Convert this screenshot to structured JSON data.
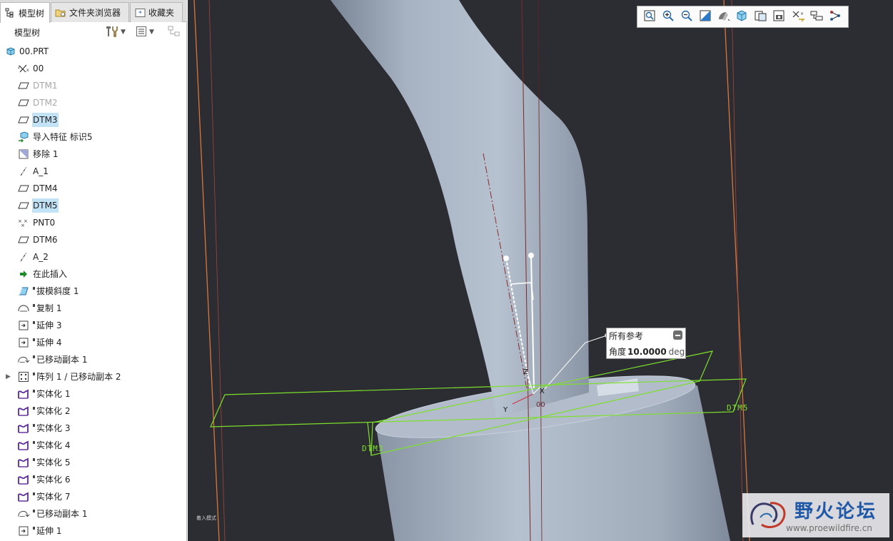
{
  "tabs": [
    {
      "label": "模型树",
      "icon": "tree-icon",
      "active": true
    },
    {
      "label": "文件夹浏览器",
      "icon": "folder-browser-icon",
      "active": false
    },
    {
      "label": "收藏夹",
      "icon": "favorites-icon",
      "active": false
    }
  ],
  "tree_header": {
    "title": "模型树"
  },
  "tree": [
    {
      "label": "00.PRT",
      "icon": "part-icon"
    },
    {
      "label": "00",
      "icon": "csys-icon"
    },
    {
      "label": "DTM1",
      "icon": "datum-plane-icon",
      "dim": true
    },
    {
      "label": "DTM2",
      "icon": "datum-plane-icon",
      "dim": true
    },
    {
      "label": "DTM3",
      "icon": "datum-plane-icon",
      "selected": true
    },
    {
      "label": "导入特征 标识5",
      "icon": "import-feature-icon"
    },
    {
      "label": "移除 1",
      "icon": "remove-icon"
    },
    {
      "label": "A_1",
      "icon": "datum-axis-icon"
    },
    {
      "label": "DTM4",
      "icon": "datum-plane-icon"
    },
    {
      "label": "DTM5",
      "icon": "datum-plane-icon",
      "selected": true
    },
    {
      "label": "PNT0",
      "icon": "datum-point-icon"
    },
    {
      "label": "DTM6",
      "icon": "datum-plane-icon"
    },
    {
      "label": "A_2",
      "icon": "datum-axis-icon"
    },
    {
      "label": "在此插入",
      "icon": "insert-here-arrow-icon"
    },
    {
      "label": "拔模斜度 1",
      "icon": "draft-icon",
      "marker": true
    },
    {
      "label": "复制 1",
      "icon": "copy-icon",
      "marker": true
    },
    {
      "label": "延伸 3",
      "icon": "extend-icon",
      "marker": true
    },
    {
      "label": "延伸 4",
      "icon": "extend-icon",
      "marker": true
    },
    {
      "label": "已移动副本 1",
      "icon": "moved-copy-icon",
      "marker": true
    },
    {
      "label": "阵列 1 / 已移动副本 2",
      "icon": "pattern-icon",
      "marker": true,
      "expandable": true
    },
    {
      "label": "实体化 1",
      "icon": "solidify-icon",
      "marker": true
    },
    {
      "label": "实体化 2",
      "icon": "solidify-icon",
      "marker": true
    },
    {
      "label": "实体化 3",
      "icon": "solidify-icon",
      "marker": true
    },
    {
      "label": "实体化 4",
      "icon": "solidify-icon",
      "marker": true
    },
    {
      "label": "实体化 5",
      "icon": "solidify-icon",
      "marker": true
    },
    {
      "label": "实体化 6",
      "icon": "solidify-icon",
      "marker": true
    },
    {
      "label": "实体化 7",
      "icon": "solidify-icon",
      "marker": true
    },
    {
      "label": "已移动副本 1",
      "icon": "moved-copy-icon",
      "marker": true
    },
    {
      "label": "延伸 1",
      "icon": "extend-icon",
      "marker": true
    }
  ],
  "view_toolbar": [
    "refit-icon",
    "zoom-in-icon",
    "zoom-out-icon",
    "repaint-icon",
    "display-style-icon",
    "saved-orientations-icon",
    "view-manager-icon",
    "perspective-icon",
    "datum-display-icon",
    "spin-center-icon",
    "annotation-display-icon"
  ],
  "dimension_callout": {
    "header": "所有参考",
    "label": "角度",
    "value": "10.0000",
    "unit": "deg"
  },
  "scene_labels": {
    "dtm3": "DTM3",
    "dtm5": "DTM5",
    "axis_x": "X",
    "axis_y": "Y",
    "axis_z": "Z",
    "csys": "00"
  },
  "status_text": "着入模式",
  "watermark": {
    "name": "野火论坛",
    "url": "www.proewildfire.cn"
  },
  "colors": {
    "viewport_bg": "#2c2c33",
    "selection_bg": "#c2e2f6",
    "datum_plane": "#7ce02a",
    "boundary_line": "#d9773a",
    "watermark_text": "#1f58a6"
  }
}
